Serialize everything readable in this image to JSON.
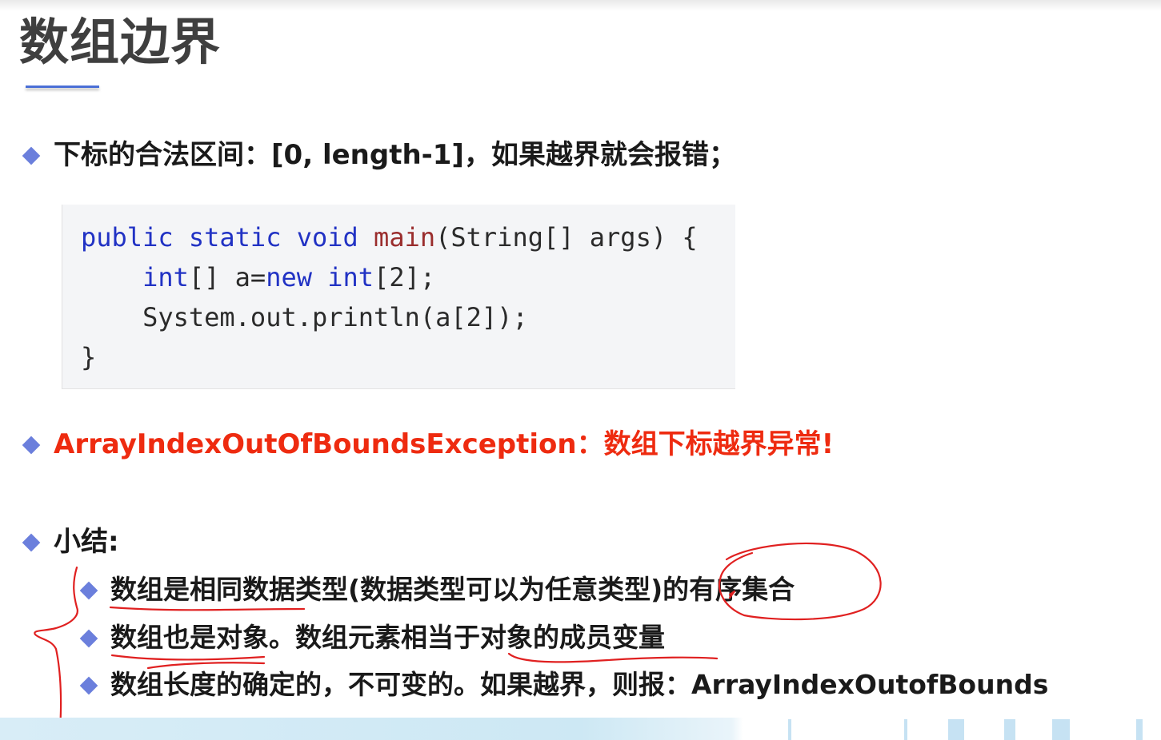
{
  "title": "数组边界",
  "bullets": {
    "range": "下标的合法区间：[0, length-1]，如果越界就会报错；",
    "exception": "ArrayIndexOutOfBoundsException：数组下标越界异常!",
    "summary": "小结:"
  },
  "code": {
    "line1": {
      "kw": "public static void",
      "fn": "main",
      "rest": "(String[] args) {"
    },
    "line2": {
      "indent": "    ",
      "kw1": "int",
      "mid": "[] a=",
      "kw2": "new",
      "sp": " ",
      "kw3": "int",
      "rest": "[2];"
    },
    "line3": "    System.out.println(a[2]);",
    "line4": "}"
  },
  "summary_items": [
    "数组是相同数据类型(数据类型可以为任意类型)的有序集合",
    "数组也是对象。数组元素相当于对象的成员变量",
    "数组长度的确定的，不可变的。如果越界，则报：ArrayIndexOutofBounds"
  ],
  "colors": {
    "bullet": "#6b7fdc",
    "accent_red": "#ee2b10",
    "keyword_blue": "#2132c4",
    "method_brown": "#9a2d2d",
    "ink_red": "#e02020"
  },
  "icons": {
    "bullet": "diamond-bullet-icon"
  }
}
